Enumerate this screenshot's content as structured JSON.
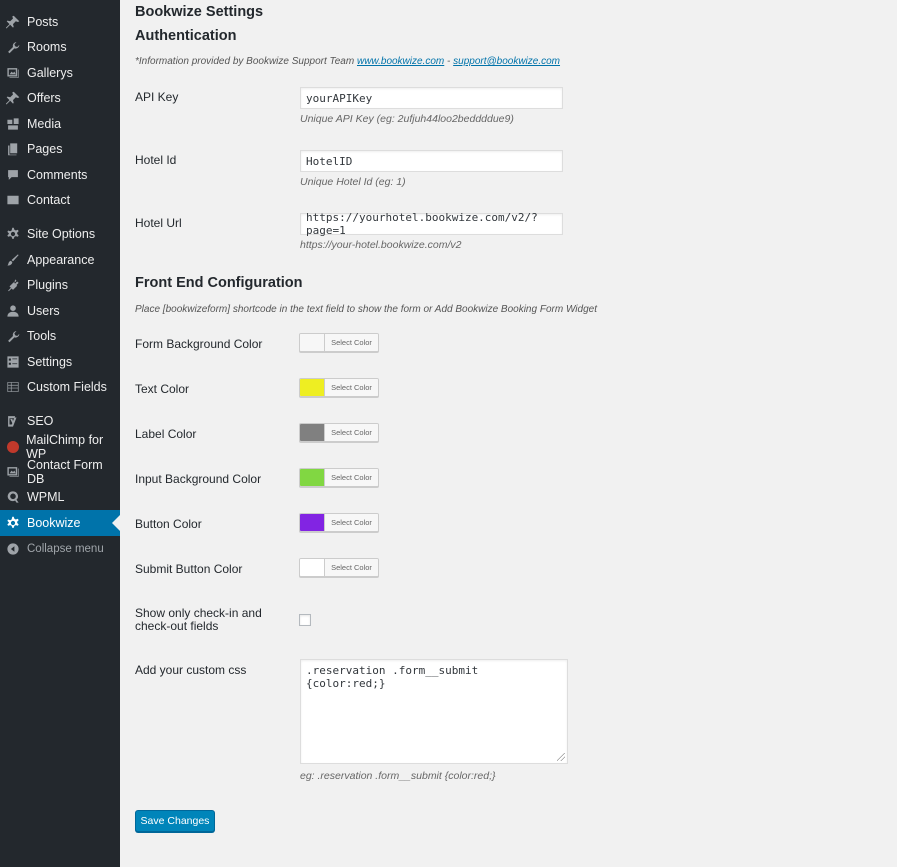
{
  "sidebar": {
    "items": [
      {
        "label": "Posts",
        "icon": "pin-icon"
      },
      {
        "label": "Rooms",
        "icon": "wrench-icon"
      },
      {
        "label": "Gallerys",
        "icon": "gallery-icon"
      },
      {
        "label": "Offers",
        "icon": "pin-icon"
      },
      {
        "label": "Media",
        "icon": "media-icon"
      },
      {
        "label": "Pages",
        "icon": "pages-icon"
      },
      {
        "label": "Comments",
        "icon": "comment-icon"
      },
      {
        "label": "Contact",
        "icon": "mail-icon"
      },
      {
        "label": "Site Options",
        "icon": "gear-icon"
      },
      {
        "label": "Appearance",
        "icon": "brush-icon"
      },
      {
        "label": "Plugins",
        "icon": "plug-icon"
      },
      {
        "label": "Users",
        "icon": "user-icon"
      },
      {
        "label": "Tools",
        "icon": "wrench-icon"
      },
      {
        "label": "Settings",
        "icon": "settings-icon"
      },
      {
        "label": "Custom Fields",
        "icon": "grid-icon"
      },
      {
        "label": "SEO",
        "icon": "yoast-icon"
      },
      {
        "label": "MailChimp for WP",
        "icon": "mailchimp-icon"
      },
      {
        "label": "Contact Form DB",
        "icon": "gallery-icon"
      },
      {
        "label": "WPML",
        "icon": "wpml-icon"
      },
      {
        "label": "Bookwize",
        "icon": "gear-icon",
        "active": true
      }
    ],
    "collapse_label": "Collapse menu"
  },
  "page": {
    "title": "Bookwize Settings",
    "auth_heading": "Authentication",
    "info_prefix": "*Information provided by Bookwize Support Team ",
    "info_link1": "www.bookwize.com",
    "info_sep": " - ",
    "info_link2": "support@bookwize.com"
  },
  "auth_fields": [
    {
      "label": "API Key",
      "value": "yourAPIKey",
      "desc": "Unique API Key (eg: 2ufjuh44loo2beddddue9)"
    },
    {
      "label": "Hotel Id",
      "value": "HotelID",
      "desc": "Unique Hotel Id (eg: 1)"
    },
    {
      "label": "Hotel Url",
      "value": "https://yourhotel.bookwize.com/v2/?page=1",
      "desc": "https://your-hotel.bookwize.com/v2"
    }
  ],
  "frontend": {
    "heading": "Front End Configuration",
    "info": "Place [bookwizeform] shortcode in the text field to show the form or Add Bookwize Booking Form Widget",
    "select_color_label": "Select Color",
    "colors": [
      {
        "label": "Form Background Color",
        "color": "#f7f7f7"
      },
      {
        "label": "Text Color",
        "color": "#eeee22"
      },
      {
        "label": "Label Color",
        "color": "#808080"
      },
      {
        "label": "Input Background Color",
        "color": "#81d742"
      },
      {
        "label": "Button Color",
        "color": "#8224e3"
      },
      {
        "label": "Submit Button Color",
        "color": "#ffffff"
      }
    ],
    "checkin_label_line1": "Show only check-in and",
    "checkin_label_line2": "check-out fields",
    "checkin_checked": false,
    "css_label": "Add your custom css",
    "css_value": ".reservation .form__submit {color:red;}",
    "css_desc": "eg: .reservation .form__submit {color:red;}"
  },
  "save_label": "Save Changes"
}
